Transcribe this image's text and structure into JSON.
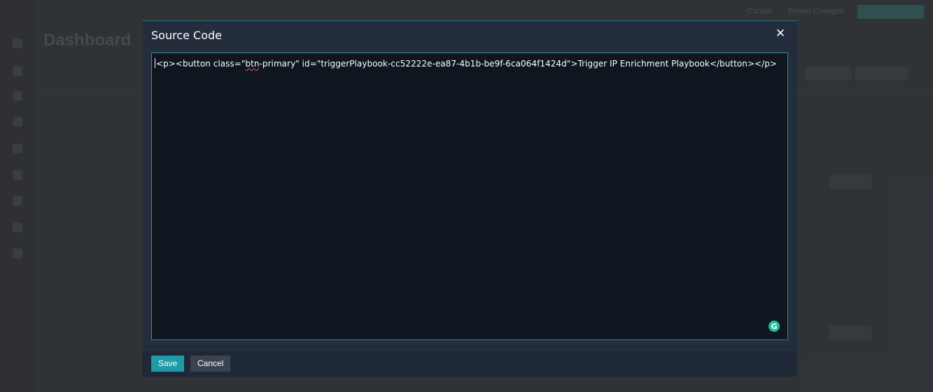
{
  "background": {
    "page_title": "Dashboard",
    "header_actions": [
      "Cancel",
      "Revert Changes"
    ]
  },
  "modal": {
    "title": "Source Code",
    "close_glyph": "✕",
    "code": {
      "prefix": "<p><button class=\"",
      "misspelled": "btn",
      "suffix": "-primary\" id=\"triggerPlaybook-cc52222e-ea87-4b1b-be9f-6ca064f1424d\">Trigger IP Enrichment Playbook</button></p>"
    },
    "grammarly_glyph": "G",
    "footer": {
      "save_label": "Save",
      "cancel_label": "Cancel"
    }
  },
  "colors": {
    "accent": "#1f9aa6",
    "modal_bg": "#232d3b",
    "editor_bg": "#0f161f",
    "editor_border": "#2f8c9a",
    "grammarly": "#15c39a"
  },
  "icons": {
    "close": "close-icon",
    "grammarly": "grammarly-icon"
  }
}
